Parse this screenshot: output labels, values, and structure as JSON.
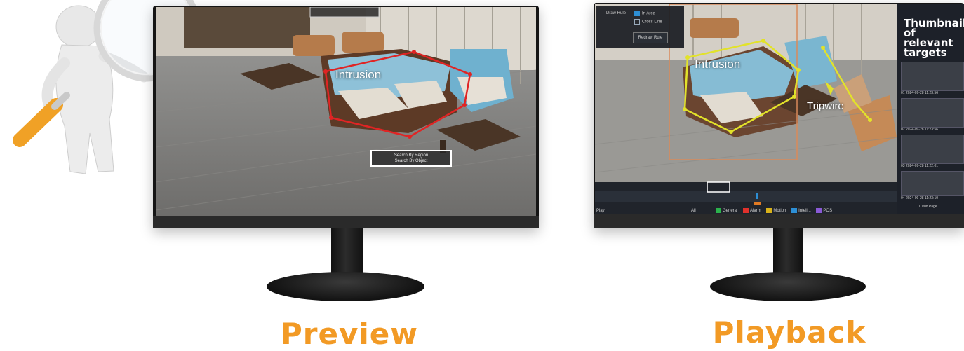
{
  "preview": {
    "caption": "Preview",
    "zone_label": "Intrusion",
    "context_menu": [
      "Search By Region",
      "Search By Object"
    ]
  },
  "playback": {
    "caption": "Playback",
    "rule_panel": {
      "draw_rule_label": "Draw Rule",
      "option_1": "In Area",
      "option_2": "Cross Line",
      "redraw_button": "Redraw Rule"
    },
    "zone_label": "Intrusion",
    "line_label": "Tripwire",
    "thumbnail_title": "Thumbnail of relevant targets",
    "thumbnails": [
      "01 2024-09-28 11:23:56",
      "02 2024-09-28 11:23:56",
      "03 2024-09-28 11:22:01",
      "04 2024-09-28 11:23:10"
    ],
    "pager": "01/08 Page",
    "timeline": {
      "play_label": "Play",
      "all_label": "All",
      "legend": [
        {
          "label": "General",
          "color": "#2bb24c"
        },
        {
          "label": "Alarm",
          "color": "#e0312b"
        },
        {
          "label": "Motion",
          "color": "#d9b21a"
        },
        {
          "label": "Intell...",
          "color": "#2d8fd5"
        },
        {
          "label": "POS",
          "color": "#8a5ad6"
        }
      ]
    }
  },
  "colors": {
    "caption": "#f29a25",
    "intrusion_preview": "#e02424",
    "intrusion_playback": "#e2e22a"
  }
}
